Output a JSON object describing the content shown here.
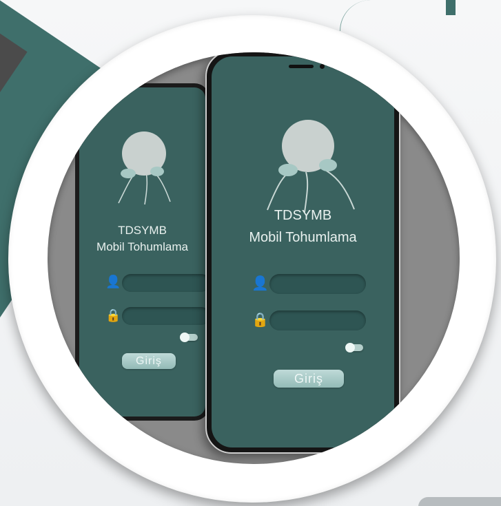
{
  "app": {
    "title": "TDSYMB",
    "subtitle": "Mobil Tohumlama",
    "login_label": "Giriş",
    "back_login_label": "Giriş"
  },
  "icons": {
    "username": "user-icon",
    "password": "lock-icon",
    "remember": "toggle-switch",
    "logo": "sperm-egg-logo"
  },
  "colors": {
    "brand_teal": "#3f6f6b",
    "screen_bg": "#3a625f",
    "button": "#a9cfcb"
  }
}
